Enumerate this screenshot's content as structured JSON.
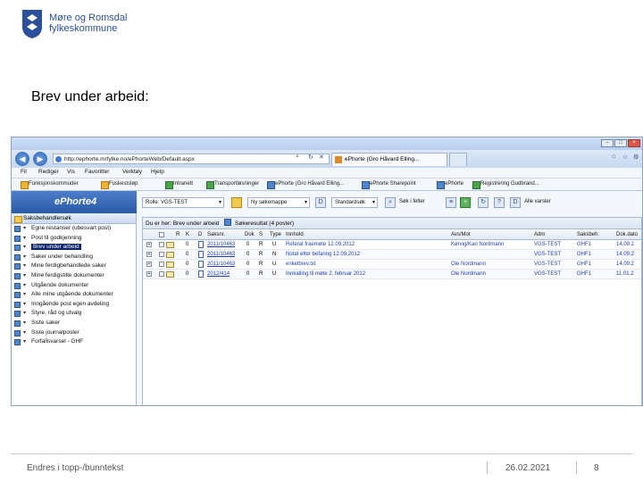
{
  "header": {
    "org_line1": "Møre og Romsdal",
    "org_line2": "fylkeskommune",
    "brand_color": "#2b4f9b"
  },
  "slide": {
    "title": "Brev under arbeid:"
  },
  "browser": {
    "url": "http://ephorte.mrfylke.no/ePhorteWeb/Default.aspx",
    "tabs": [
      {
        "label": "ePhorte (Gro Håvard Elling..."
      },
      {
        "label": ""
      }
    ],
    "menu": [
      "Fil",
      "Rediger",
      "Vis",
      "Favoritter",
      "Verktøy",
      "Hjelp"
    ],
    "favorites": [
      {
        "label": "Funksjonskommuder",
        "icon": "folder-icon"
      },
      {
        "label": "Fuskestsløp",
        "icon": "folder-icon"
      },
      {
        "label": "Intranett",
        "icon": "page-icon"
      },
      {
        "label": "Transportløsninger",
        "icon": "page-icon"
      },
      {
        "label": "ePhorte (Gro Håvard Elling...",
        "icon": "page-icon"
      },
      {
        "label": "ePhorte Sharepoint",
        "icon": "page-icon"
      },
      {
        "label": "ePhorte",
        "icon": "page-icon"
      },
      {
        "label": "Registrering Gudbrand...",
        "icon": "page-icon"
      }
    ]
  },
  "app": {
    "brand": "ePhorte4",
    "toolbar": {
      "role_select": "Rolle: VGS-TEST",
      "search_select": "Ny søkemappe",
      "view_select": "Standardsøk",
      "search_label": "Søk i felter",
      "alert_label": "Alle varsler"
    },
    "left_panel": {
      "title": "Saksbehandlersøk",
      "items": [
        {
          "label": "Egne restanser (ubesvart post)",
          "selected": false
        },
        {
          "label": "Post til godkjenning",
          "selected": false
        },
        {
          "label": "Brev under arbeid",
          "selected": true
        },
        {
          "label": "Saker under behandling",
          "selected": false
        },
        {
          "label": "Mine ferdigbehandlede saker",
          "selected": false
        },
        {
          "label": "Mine ferdigstilte dokumenter",
          "selected": false
        },
        {
          "label": "Utgående dokumenter",
          "selected": false
        },
        {
          "label": "Alle mine utgående dokumenter",
          "selected": false
        },
        {
          "label": "Inngående post egen avdeling",
          "selected": false
        },
        {
          "label": "Styre, råd og utvalg",
          "selected": false
        },
        {
          "label": "Siste saker",
          "selected": false
        },
        {
          "label": "Siste journalposter",
          "selected": false
        },
        {
          "label": "Forfallsvarsel - GHF",
          "selected": false
        }
      ]
    },
    "main": {
      "crumb_prefix": "Du er her:",
      "crumb_current": "Brev under arbeid",
      "result_label": "Søkeresultat (4 poster)",
      "columns": [
        "R",
        "K",
        "D",
        "Saksnr.",
        "Dok",
        "S",
        "Type",
        "Innhold",
        "Avs/Mot",
        "Adm",
        "Saksbeh.",
        "Dok.dato"
      ],
      "rows": [
        {
          "flag": "0",
          "r": "R",
          "saksnr": "2011/10463",
          "dok": "0",
          "s": "R",
          "type": "U",
          "innhold": "Referat fraemøte 12.09.2012",
          "avsmot": "Kørvig/Kari Nordmann",
          "adm": "VGS-TEST",
          "saksbeh": "GHF1",
          "dato": "14.09.2"
        },
        {
          "flag": "0",
          "r": "R",
          "saksnr": "2011/10463",
          "dok": "0",
          "s": "R",
          "type": "N",
          "innhold": "Notat etter befaring 12.09.2012",
          "avsmot": "",
          "adm": "VGS-TEST",
          "saksbeh": "GHF1",
          "dato": "14.09.2"
        },
        {
          "flag": "0",
          "r": "R",
          "saksnr": "2011/10463",
          "dok": "0",
          "s": "R",
          "type": "U",
          "innhold": "enkelbrev.txt",
          "avsmot": "Ole Nordmann",
          "adm": "VGS-TEST",
          "saksbeh": "GHF1",
          "dato": "14.09.2"
        },
        {
          "flag": "0",
          "r": "R",
          "saksnr": "2012/414",
          "dok": "0",
          "s": "R",
          "type": "U",
          "innhold": "Innkalling til møte 2. februar 2012",
          "avsmot": "Ole Nordmann",
          "adm": "VGS-TEST",
          "saksbeh": "GHF1",
          "dato": "11.01.2"
        }
      ]
    }
  },
  "footer": {
    "text": "Endres i topp-/bunntekst",
    "date": "26.02.2021",
    "page": "8"
  }
}
